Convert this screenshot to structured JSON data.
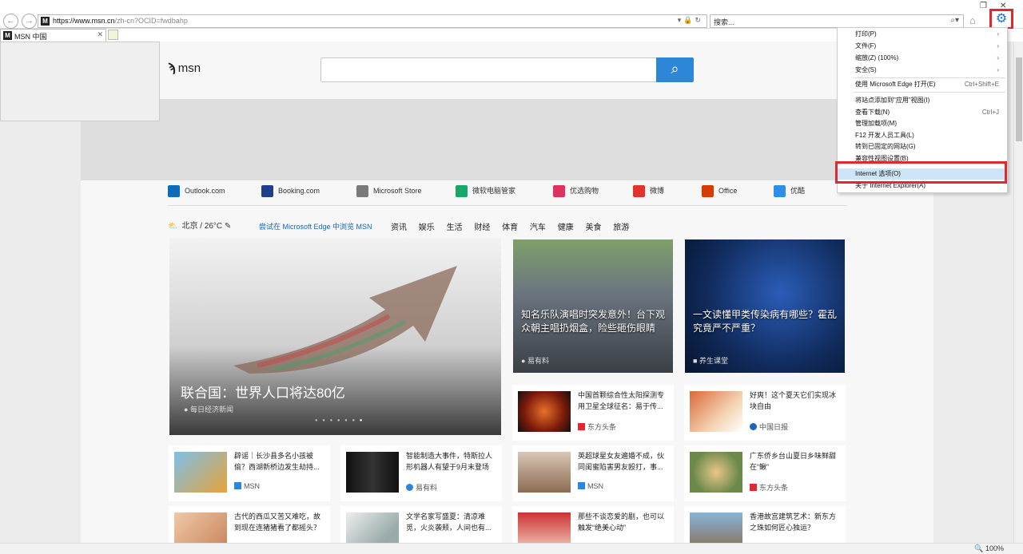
{
  "browser": {
    "url_host": "https://www.msn.cn",
    "url_path": "/zh-cn?OCID=fwdbahp",
    "search_placeholder": "搜索...",
    "tab_title": "MSN 中国",
    "zoom": "100%"
  },
  "msn": {
    "logo_text": "msn"
  },
  "quick_links": [
    {
      "label": "Outlook.com",
      "color": "#0b6cbd"
    },
    {
      "label": "Booking.com",
      "color": "#1f3f8c"
    },
    {
      "label": "Microsoft Store",
      "color": "#7a7a7a"
    },
    {
      "label": "微软电脑管家",
      "color": "#19a66a"
    },
    {
      "label": "优选购物",
      "color": "#e0325e"
    },
    {
      "label": "微博",
      "color": "#e3332a"
    },
    {
      "label": "Office",
      "color": "#d83b01"
    },
    {
      "label": "优酷",
      "color": "#2f8fe8"
    }
  ],
  "weather": {
    "text": "北京 / 26°C",
    "edit_icon": "pencil-icon"
  },
  "edge_link": "尝试在 Microsoft Edge 中浏览 MSN",
  "categories": [
    "资讯",
    "娱乐",
    "生活",
    "财经",
    "体育",
    "汽车",
    "健康",
    "美食",
    "旅游"
  ],
  "hero": {
    "title": "联合国：世界人口将达80亿",
    "source": "每日经济新闻"
  },
  "image_cards": [
    {
      "title": "知名乐队演唱时突发意外！台下观众朝主唱扔烟盒，险些砸伤眼睛",
      "source": "易有料"
    },
    {
      "title": "一文读懂甲类传染病有哪些？霍乱究竟严不严重？",
      "source": "养生课堂"
    }
  ],
  "small_cards": [
    {
      "text": "中国首颗综合性太阳探测专用卫星全球征名：易于传...",
      "source": "东方头条"
    },
    {
      "text": "好爽！这个夏天它们实现冰块自由",
      "source": "中国日报"
    },
    {
      "text": "辟谣｜长沙县多名小孩被偷？西湖新桥边发生劫持...",
      "source": "MSN"
    },
    {
      "text": "智能制造大事件，特斯拉人形机器人有望于9月末登场",
      "source": "易有料"
    },
    {
      "text": "英超球星女友遍婚不成，伙同闺蜜陷害男友殴打，事...",
      "source": "MSN"
    },
    {
      "text": "广东侨乡台山夏日乡味鲜甜在“鳅”",
      "source": "东方头条"
    },
    {
      "text": "古代的西瓜又苦又难吃，故到现在连猪猪看了都摇头？",
      "source": ""
    },
    {
      "text": "文学名家写盛夏：清凉难觅，火炎袭颊，人间也有...",
      "source": ""
    },
    {
      "text": "那些不谈恋爱的剧，也可以触发“绝美心动”",
      "source": ""
    },
    {
      "text": "香港故宫建筑艺术：新东方之珠如何匠心独运？",
      "source": ""
    }
  ],
  "tools_menu": {
    "items": [
      {
        "label": "打印(P)",
        "arrow": "›",
        "shortcut": ""
      },
      {
        "label": "文件(F)",
        "arrow": "›",
        "shortcut": ""
      },
      {
        "label": "缩放(Z) (100%)",
        "arrow": "›",
        "shortcut": ""
      },
      {
        "label": "安全(S)",
        "arrow": "›",
        "shortcut": ""
      },
      {
        "label": "使用 Microsoft Edge 打开(E)",
        "arrow": "",
        "shortcut": "Ctrl+Shift+E"
      },
      {
        "label": "将站点添加到\"应用\"视图(I)",
        "arrow": "",
        "shortcut": ""
      },
      {
        "label": "查看下载(N)",
        "arrow": "",
        "shortcut": "Ctrl+J"
      },
      {
        "label": "管理加载项(M)",
        "arrow": "",
        "shortcut": ""
      },
      {
        "label": "F12 开发人员工具(L)",
        "arrow": "",
        "shortcut": ""
      },
      {
        "label": "转到已固定的网站(G)",
        "arrow": "",
        "shortcut": ""
      },
      {
        "label": "兼容性视图设置(B)",
        "arrow": "",
        "shortcut": ""
      },
      {
        "label": "Internet 选项(O)",
        "arrow": "",
        "shortcut": ""
      },
      {
        "label": "关于 Internet Explorer(A)",
        "arrow": "",
        "shortcut": ""
      }
    ]
  },
  "colors": {
    "accent": "#2e86d8",
    "highlight_frame": "#e0282e",
    "menu_highlight": "#cde5f7"
  }
}
